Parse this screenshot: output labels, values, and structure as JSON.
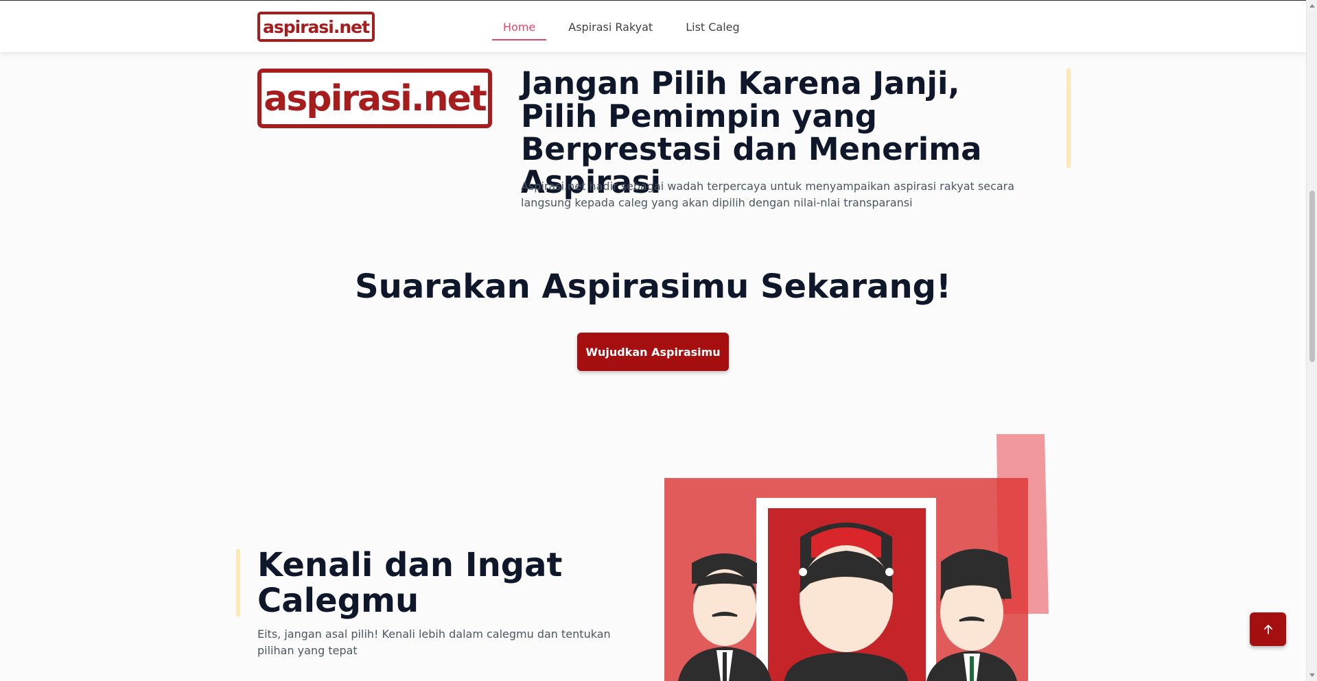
{
  "header": {
    "logo_text": "aspirasi.net",
    "nav": [
      {
        "label": "Home",
        "active": true
      },
      {
        "label": "Aspirasi Rakyat",
        "active": false
      },
      {
        "label": "List Caleg",
        "active": false
      }
    ]
  },
  "hero": {
    "logo_text": "aspirasi.net",
    "title": "Jangan Pilih Karena Janji, Pilih Pemimpin yang Berprestasi dan Menerima Aspirasi",
    "subtitle": "Aspirasi.net hadir sebagai wadah terpercaya untuk menyampaikan aspirasi rakyat secara langsung kepada caleg yang akan dipilih dengan nilai-nlai transparansi"
  },
  "cta": {
    "title": "Suarakan Aspirasimu Sekarang!",
    "button_label": "Wujudkan Aspirasimu"
  },
  "caleg_section": {
    "title": "Kenali dan Ingat Calegmu",
    "subtitle": "Eits, jangan asal pilih! Kenali lebih dalam calegmu dan tentukan pilihan yang tepat",
    "illustration": "three-candidates-illustration"
  },
  "back_to_top_icon": "arrow-up-icon",
  "colors": {
    "brand_red": "#a50f0f",
    "active_nav": "#e0466b",
    "accent_bar": "#fde8b8"
  }
}
